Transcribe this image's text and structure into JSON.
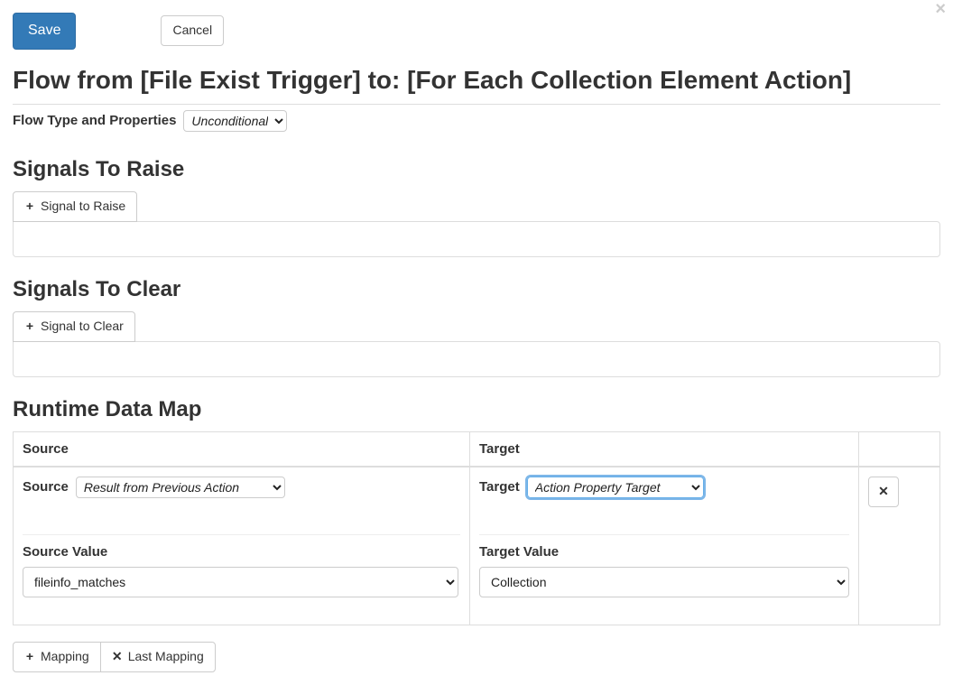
{
  "buttons": {
    "save": "Save",
    "cancel": "Cancel",
    "signal_to_raise": "Signal to Raise",
    "signal_to_clear": "Signal to Clear",
    "mapping": "Mapping",
    "last_mapping": "Last Mapping"
  },
  "page_title": "Flow from [File Exist Trigger] to: [For Each Collection Element Action]",
  "flow_type": {
    "label": "Flow Type and Properties",
    "selected": "Unconditional"
  },
  "sections": {
    "signals_to_raise": "Signals To Raise",
    "signals_to_clear": "Signals To Clear",
    "runtime_data_map": "Runtime Data Map"
  },
  "datamap": {
    "headers": {
      "source": "Source",
      "target": "Target"
    },
    "rows": [
      {
        "source_label": "Source",
        "source_selected": "Result from Previous Action",
        "source_value_label": "Source Value",
        "source_value_selected": "fileinfo_matches",
        "target_label": "Target",
        "target_selected": "Action Property Target",
        "target_value_label": "Target Value",
        "target_value_selected": "Collection"
      }
    ]
  }
}
